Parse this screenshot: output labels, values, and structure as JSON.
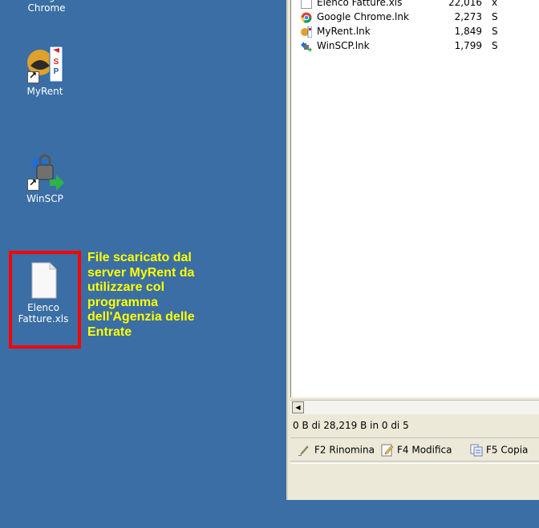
{
  "desktop": {
    "icons": [
      {
        "name": "chrome",
        "label": "Google\nChrome"
      },
      {
        "name": "myrent",
        "label": "MyRent"
      },
      {
        "name": "winscp",
        "label": "WinSCP"
      },
      {
        "name": "elenco-fatture",
        "label": "Elenco\nFatture.xls"
      }
    ],
    "annotation": "File scaricato dal\nserver MyRent da\nutilizzare col\nprogramma\ndell'Agenzia delle\nEntrate"
  },
  "window": {
    "files": [
      {
        "name": "Elenco Fatture.xls",
        "size": "22,016",
        "type": "x"
      },
      {
        "name": "Google Chrome.lnk",
        "size": "2,273",
        "type": "S"
      },
      {
        "name": "MyRent.lnk",
        "size": "1,849",
        "type": "S"
      },
      {
        "name": "WinSCP.lnk",
        "size": "1,799",
        "type": "S"
      }
    ],
    "status": "0 B di 28,219 B in 0 di 5",
    "fkeys": [
      {
        "label": "F2 Rinomina"
      },
      {
        "label": "F4 Modifica"
      },
      {
        "label": "F5 Copia"
      }
    ]
  },
  "colors": {
    "desktop": "#3a6ea5",
    "annotation": "#ffff00",
    "highlight": "#ff0000"
  }
}
